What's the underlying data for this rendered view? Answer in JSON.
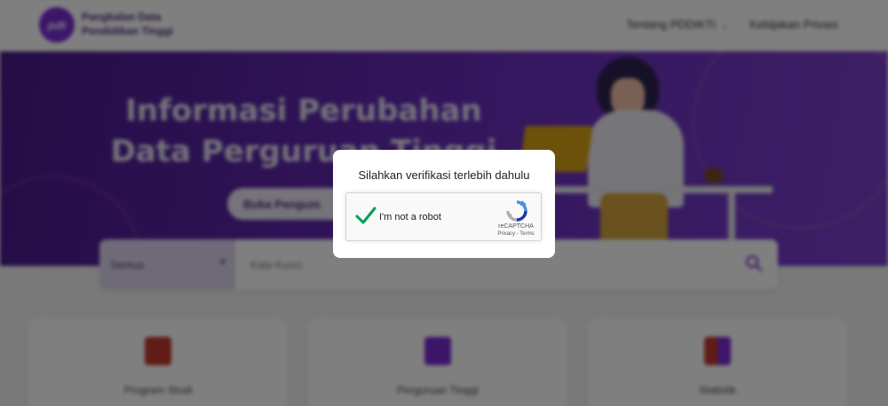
{
  "header": {
    "logo_mark": "pdt",
    "logo_text_line1": "Pangkalan Data",
    "logo_text_line2": "Pendidikan Tinggi",
    "nav_about": "Tentang PDDIKTI",
    "nav_privacy": "Kebijakan Privasi"
  },
  "hero": {
    "title_line1": "Informasi Perubahan",
    "title_line2": "Data Perguruan Tinggi",
    "button_label": "Buka Pengum"
  },
  "search": {
    "category_selected": "Semua",
    "placeholder": "Kata Kunci"
  },
  "cards": [
    {
      "label": "Program Studi"
    },
    {
      "label": "Perguruan Tinggi"
    },
    {
      "label": "Statistik"
    }
  ],
  "modal": {
    "title": "Silahkan verifikasi terlebih dahulu",
    "recaptcha": {
      "label": "I'm not a robot",
      "brand": "reCAPTCHA",
      "privacy": "Privacy",
      "separator": " - ",
      "terms": "Terms",
      "checked": true
    }
  },
  "colors": {
    "brand_purple": "#6a2dbf",
    "check_green": "#009e55",
    "overlay": "rgba(0,0,0,0.5)"
  }
}
